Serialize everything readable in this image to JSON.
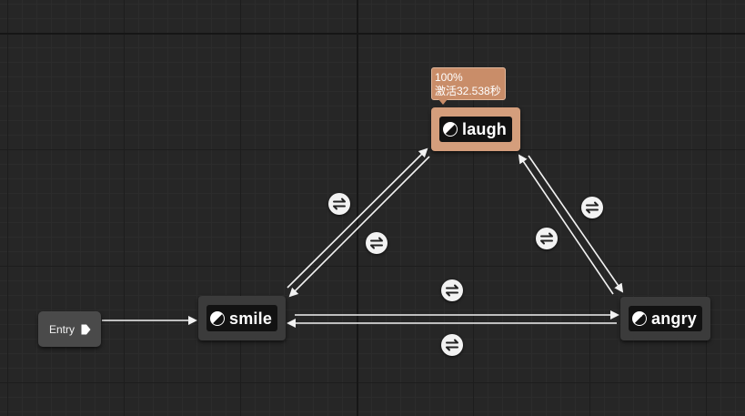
{
  "graph": {
    "entry": {
      "label": "Entry"
    },
    "states": [
      {
        "id": "laugh",
        "label": "laugh",
        "active": true
      },
      {
        "id": "smile",
        "label": "smile",
        "active": false
      },
      {
        "id": "angry",
        "label": "angry",
        "active": false
      }
    ],
    "active_tooltip": {
      "line1": "100%",
      "line2": "激活32.538秒"
    }
  },
  "icons": {
    "state": "half-circle-icon",
    "entry": "play-arrow-icon",
    "transition": "transition-rule-icon"
  },
  "colors": {
    "canvas_background": "#262626",
    "node_background": "#3b3b3b",
    "node_inner": "#121212",
    "active_node": "#d49e7c",
    "tooltip": "#c98d69",
    "edge": "#f2f2f2"
  }
}
